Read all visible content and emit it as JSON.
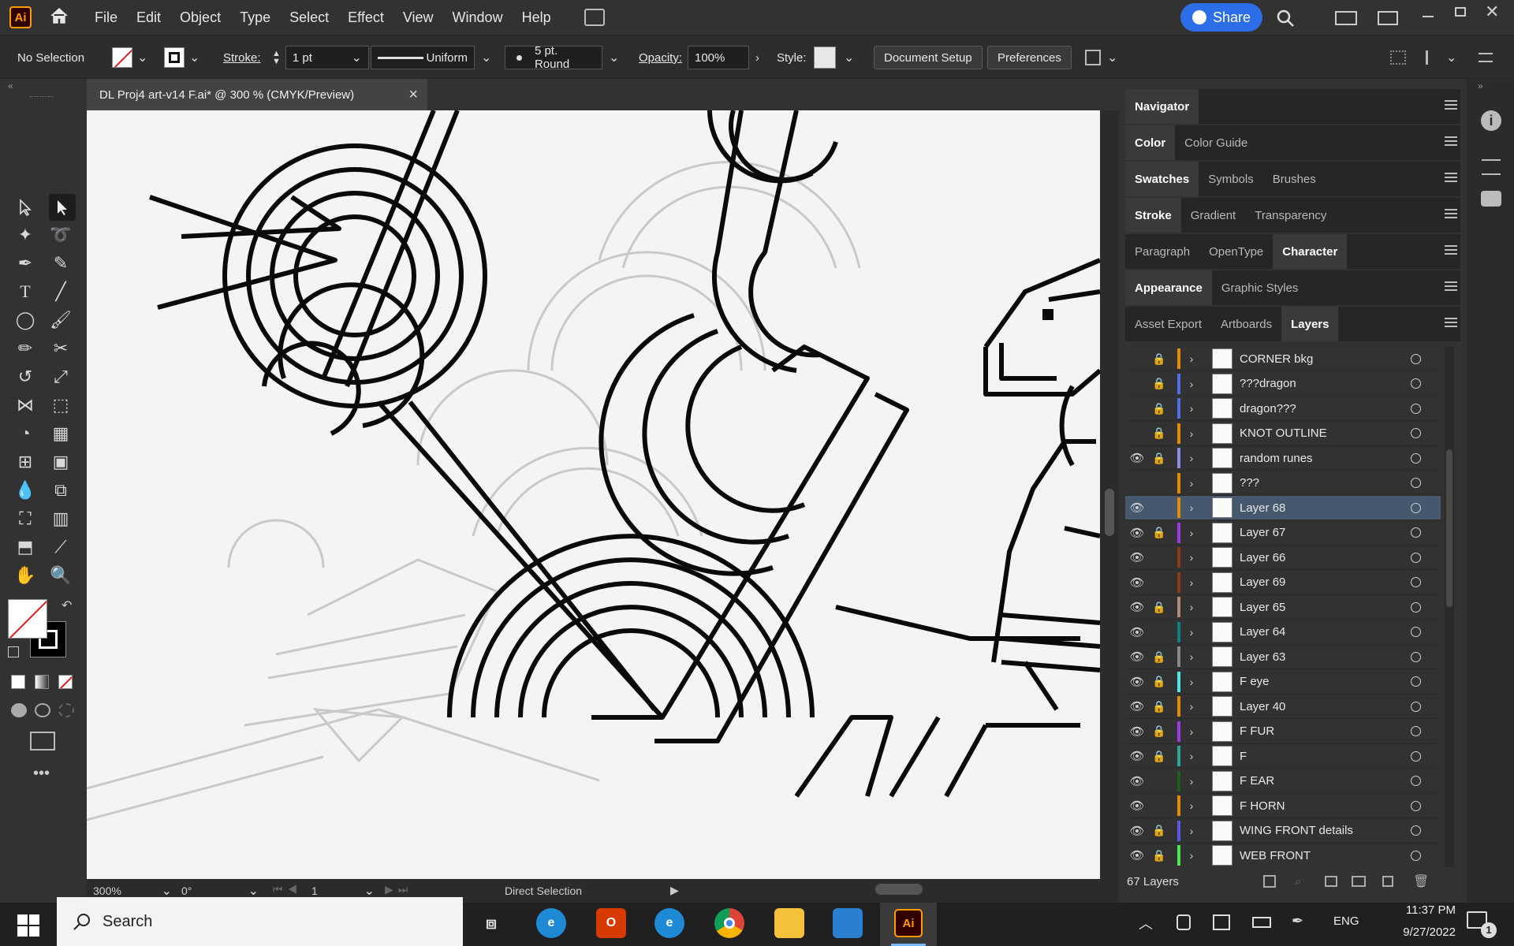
{
  "app": {
    "logo": "Ai",
    "accent": "#ff9a00"
  },
  "menubar": {
    "items": [
      "File",
      "Edit",
      "Object",
      "Type",
      "Select",
      "Effect",
      "View",
      "Window",
      "Help"
    ],
    "share_label": "Share"
  },
  "controlbar": {
    "selection_label": "No Selection",
    "stroke_label": "Stroke:",
    "stroke_value": "1 pt",
    "profile_label": "Uniform",
    "brush_label": "5 pt. Round",
    "opacity_label": "Opacity:",
    "opacity_value": "100%",
    "style_label": "Style:",
    "doc_setup_label": "Document Setup",
    "preferences_label": "Preferences"
  },
  "document": {
    "tab_title": "DL Proj4 art-v14 F.ai* @ 300 % (CMYK/Preview)",
    "close_glyph": "×"
  },
  "statusbar": {
    "zoom": "300%",
    "rotation": "0°",
    "artboard": "1",
    "tool_name": "Direct Selection"
  },
  "panels": {
    "rows": [
      {
        "tabs": [
          "Navigator"
        ],
        "active": 0
      },
      {
        "tabs": [
          "Color",
          "Color Guide"
        ],
        "active": 0
      },
      {
        "tabs": [
          "Swatches",
          "Symbols",
          "Brushes"
        ],
        "active": 0
      },
      {
        "tabs": [
          "Stroke",
          "Gradient",
          "Transparency"
        ],
        "active": 0
      },
      {
        "tabs": [
          "Paragraph",
          "OpenType",
          "Character"
        ],
        "active": 2
      },
      {
        "tabs": [
          "Appearance",
          "Graphic Styles"
        ],
        "active": 0
      },
      {
        "tabs": [
          "Asset Export",
          "Artboards",
          "Layers"
        ],
        "active": 2
      }
    ],
    "layer_count": "67 Layers"
  },
  "layers": [
    {
      "name": "CORNER bkg",
      "eye": false,
      "lock": true,
      "color": "#e68a00",
      "selected": false
    },
    {
      "name": "???dragon",
      "eye": false,
      "lock": true,
      "color": "#4f6fe8",
      "selected": false
    },
    {
      "name": "dragon???",
      "eye": false,
      "lock": true,
      "color": "#4f6fe8",
      "selected": false
    },
    {
      "name": "KNOT OUTLINE",
      "eye": false,
      "lock": true,
      "color": "#e68a00",
      "selected": false
    },
    {
      "name": "random runes",
      "eye": true,
      "lock": true,
      "color": "#8a8ae8",
      "selected": false
    },
    {
      "name": "???",
      "eye": false,
      "lock": false,
      "color": "#e68a00",
      "selected": false
    },
    {
      "name": "Layer 68",
      "eye": true,
      "lock": false,
      "color": "#e68a00",
      "selected": true
    },
    {
      "name": "Layer 67",
      "eye": true,
      "lock": true,
      "color": "#9a3ce0",
      "selected": false
    },
    {
      "name": "Layer 66",
      "eye": true,
      "lock": false,
      "color": "#8a3b12",
      "selected": false
    },
    {
      "name": "Layer 69",
      "eye": true,
      "lock": false,
      "color": "#8a3b12",
      "selected": false
    },
    {
      "name": "Layer 65",
      "eye": true,
      "lock": true,
      "color": "#b08a78",
      "selected": false
    },
    {
      "name": "Layer 64",
      "eye": true,
      "lock": false,
      "color": "#0e8080",
      "selected": false
    },
    {
      "name": "Layer 63",
      "eye": true,
      "lock": true,
      "color": "#888888",
      "selected": false
    },
    {
      "name": "F eye",
      "eye": true,
      "lock": true,
      "color": "#4ee8e8",
      "selected": false
    },
    {
      "name": "Layer 40",
      "eye": true,
      "lock": true,
      "color": "#e68a00",
      "selected": false
    },
    {
      "name": "F FUR",
      "eye": true,
      "lock": true,
      "color": "#9a3ce0",
      "selected": false
    },
    {
      "name": "F",
      "eye": true,
      "lock": true,
      "color": "#2aa898",
      "selected": false
    },
    {
      "name": "F EAR",
      "eye": true,
      "lock": false,
      "color": "#1e5e1e",
      "selected": false
    },
    {
      "name": "F HORN",
      "eye": true,
      "lock": false,
      "color": "#e68a00",
      "selected": false
    },
    {
      "name": "WING FRONT details",
      "eye": true,
      "lock": true,
      "color": "#5a5ae8",
      "selected": false
    },
    {
      "name": "WEB FRONT",
      "eye": true,
      "lock": true,
      "color": "#4ee84e",
      "selected": false
    }
  ],
  "taskbar": {
    "search_placeholder": "Search",
    "language": "ENG",
    "time": "11:37 PM",
    "date": "9/27/2022",
    "notif_count": "1"
  }
}
